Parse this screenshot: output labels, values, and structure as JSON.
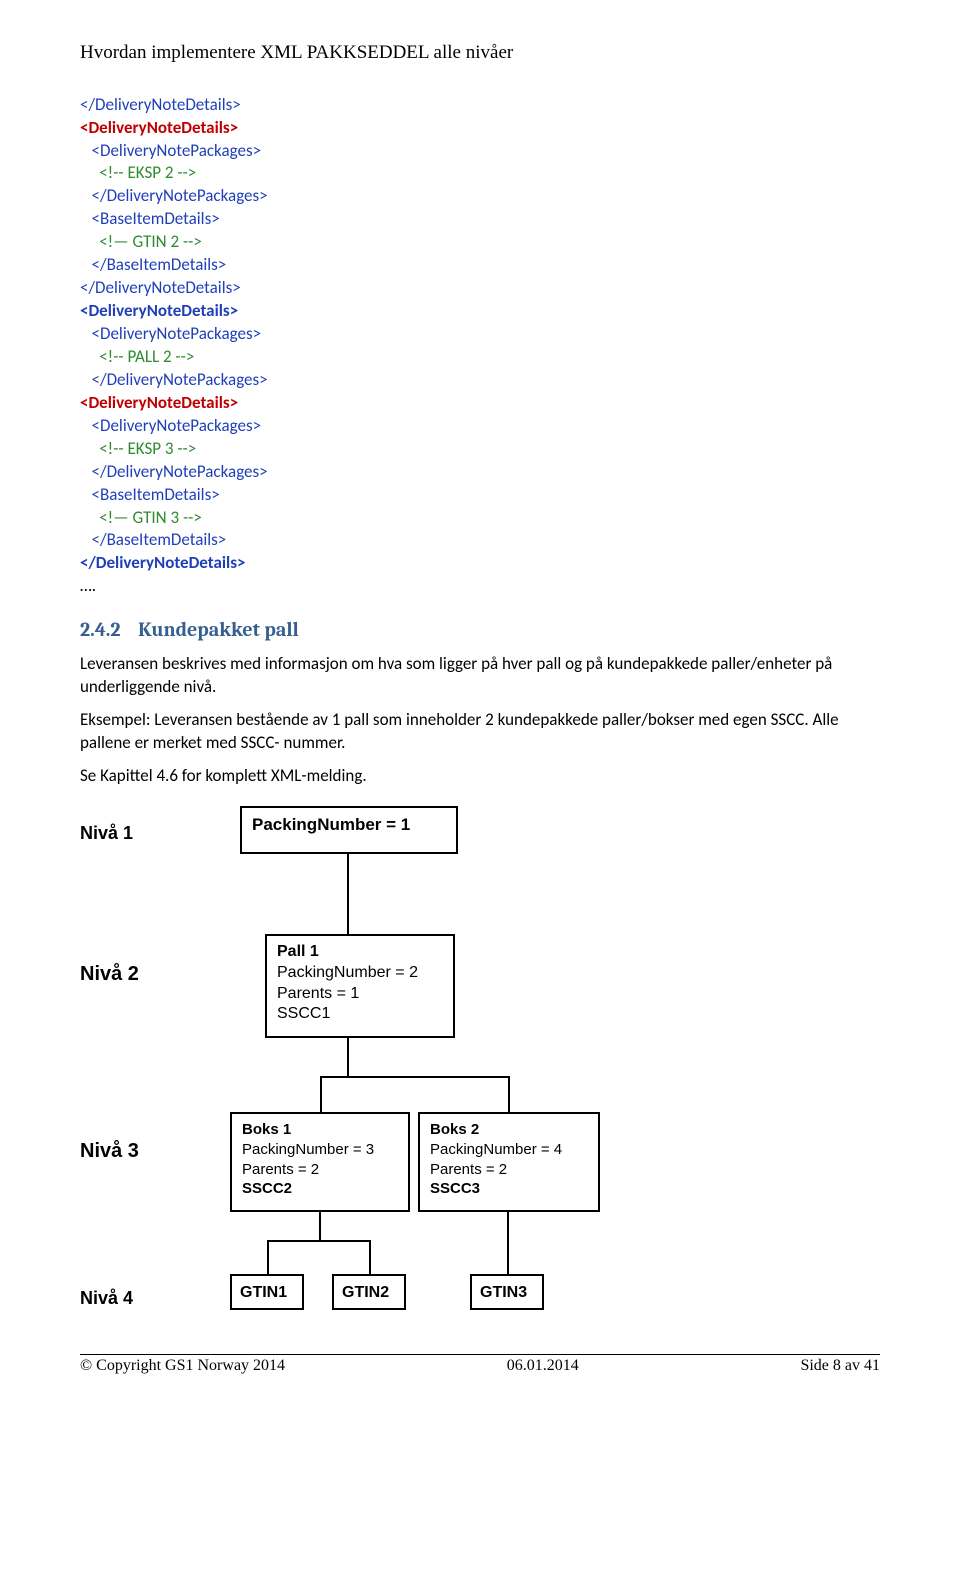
{
  "header": {
    "title": "Hvordan implementere XML PAKKSEDDEL alle nivåer"
  },
  "xml": {
    "l0": "</DeliveryNoteDetails>",
    "l1": "<DeliveryNoteDetails>",
    "l2": "<DeliveryNotePackages>",
    "l3": "<!-- EKSP 2 -->",
    "l4": "</DeliveryNotePackages>",
    "l5": "<BaseItemDetails>",
    "l6": "<!— GTIN 2 -->",
    "l7": "</BaseItemDetails>",
    "l8": "</DeliveryNoteDetails>",
    "l9": "<DeliveryNoteDetails>",
    "l10": "<DeliveryNotePackages>",
    "l11": "<!-- PALL 2 -->",
    "l12": "</DeliveryNotePackages>",
    "l13": "<DeliveryNoteDetails>",
    "l14": "<DeliveryNotePackages>",
    "l15": "<!-- EKSP 3 -->",
    "l16": "</DeliveryNotePackages>",
    "l17": "<BaseItemDetails>",
    "l18": "<!— GTIN 3 -->",
    "l19": "</BaseItemDetails>",
    "l20": "</DeliveryNoteDetails>",
    "l21": "…."
  },
  "section": {
    "num": "2.4.2",
    "title": "Kundepakket pall"
  },
  "paras": {
    "p1": "Leveransen beskrives med informasjon om hva som ligger på hver pall og på kundepakkede paller/enheter på underliggende nivå.",
    "p2": "Eksempel: Leveransen bestående av 1 pall som inneholder 2 kundepakkede paller/bokser med egen SSCC. Alle pallene er merket med SSCC- nummer.",
    "p3": "Se Kapittel 4.6 for komplett XML-melding."
  },
  "diagram": {
    "levels": {
      "n1": "Nivå 1",
      "n2": "Nivå 2",
      "n3": "Nivå 3",
      "n4": "Nivå 4"
    },
    "box1": {
      "l1": "PackingNumber = 1"
    },
    "box2": {
      "l1": "Pall 1",
      "l2": "PackingNumber = 2",
      "l3": "Parents = 1",
      "l4": "SSCC1"
    },
    "box3a": {
      "l1": "Boks 1",
      "l2": "PackingNumber = 3",
      "l3": "Parents = 2",
      "l4": "SSCC2"
    },
    "box3b": {
      "l1": "Boks 2",
      "l2": "PackingNumber  = 4",
      "l3": "Parents = 2",
      "l4": "SSCC3"
    },
    "box4a": "GTIN1",
    "box4b": "GTIN2",
    "box4c": "GTIN3"
  },
  "footer": {
    "left": "© Copyright GS1 Norway 2014",
    "center": "06.01.2014",
    "right": "Side 8 av 41"
  }
}
